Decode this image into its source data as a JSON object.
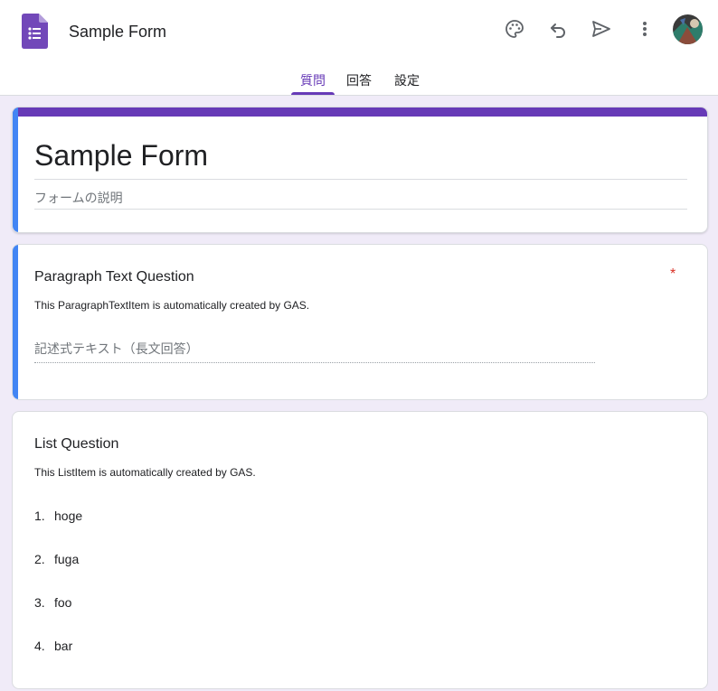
{
  "header": {
    "title": "Sample Form",
    "icons": [
      "palette-icon",
      "undo-icon",
      "send-icon",
      "more-vert-icon"
    ]
  },
  "tabs": [
    {
      "label": "質問",
      "active": true
    },
    {
      "label": "回答",
      "active": false
    },
    {
      "label": "設定",
      "active": false
    }
  ],
  "form": {
    "title": "Sample Form",
    "description_placeholder": "フォームの説明"
  },
  "questions": [
    {
      "title": "Paragraph Text Question",
      "description": "This ParagraphTextItem is automatically created by GAS.",
      "required_mark": "*",
      "answer_placeholder": "記述式テキスト（長文回答）"
    },
    {
      "title": "List Question",
      "description": "This ListItem is automatically created by GAS.",
      "options": [
        {
          "num": "1.",
          "label": "hoge"
        },
        {
          "num": "2.",
          "label": "fuga"
        },
        {
          "num": "3.",
          "label": "foo"
        },
        {
          "num": "4.",
          "label": "bar"
        }
      ]
    }
  ],
  "colors": {
    "accent": "#673ab7",
    "focus": "#4285f4",
    "background": "#f0ebf8",
    "required": "#d93025"
  }
}
